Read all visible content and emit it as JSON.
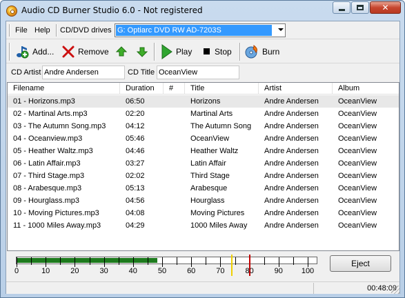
{
  "window": {
    "title": "Audio CD Burner Studio 6.0 - Not registered"
  },
  "menu": {
    "file": "File",
    "help": "Help"
  },
  "drives": {
    "label": "CD/DVD drives",
    "selected": "G: Optiarc DVD RW AD-7203S"
  },
  "toolbar": {
    "add": "Add...",
    "remove": "Remove",
    "play": "Play",
    "stop": "Stop",
    "burn": "Burn"
  },
  "cd": {
    "artist_label": "CD Artist",
    "artist_value": "Andre Andersen",
    "title_label": "CD Title",
    "title_value": "OceanView"
  },
  "table": {
    "columns": [
      "Filename",
      "Duration",
      "#",
      "Title",
      "Artist",
      "Album"
    ],
    "rows": [
      [
        "01 - Horizons.mp3",
        "06:50",
        "",
        "Horizons",
        "Andre Andersen",
        "OceanView"
      ],
      [
        "02 - Martinal Arts.mp3",
        "02:20",
        "",
        "Martinal Arts",
        "Andre Andersen",
        "OceanView"
      ],
      [
        "03 - The Autumn Song.mp3",
        "04:12",
        "",
        "The Autumn Song",
        "Andre Andersen",
        "OceanView"
      ],
      [
        "04 - Oceanview.mp3",
        "05:46",
        "",
        "OceanView",
        "Andre Andersen",
        "OceanView"
      ],
      [
        "05 - Heather Waltz.mp3",
        "04:46",
        "",
        "Heather Waltz",
        "Andre Andersen",
        "OceanView"
      ],
      [
        "06 - Latin Affair.mp3",
        "03:27",
        "",
        "Latin Affair",
        "Andre Andersen",
        "OceanView"
      ],
      [
        "07 - Third Stage.mp3",
        "02:02",
        "",
        "Third Stage",
        "Andre Andersen",
        "OceanView"
      ],
      [
        "08 - Arabesque.mp3",
        "05:13",
        "",
        "Arabesque",
        "Andre Andersen",
        "OceanView"
      ],
      [
        "09 - Hourglass.mp3",
        "04:56",
        "",
        "Hourglass",
        "Andre Andersen",
        "OceanView"
      ],
      [
        "10 - Moving Pictures.mp3",
        "04:08",
        "",
        "Moving Pictures",
        "Andre Andersen",
        "OceanView"
      ],
      [
        "11 - 1000 Miles Away.mp3",
        "04:29",
        "",
        "1000 Miles Away",
        "Andre Andersen",
        "OceanView"
      ]
    ],
    "selected_row": 0
  },
  "gauge": {
    "scale_labels": [
      "0",
      "10",
      "20",
      "30",
      "40",
      "50",
      "60",
      "70",
      "80",
      "90",
      "100"
    ],
    "filled_minutes": 48,
    "markers": [
      {
        "minutes": 74,
        "color": "#f0d000"
      },
      {
        "minutes": 80,
        "color": "#c00000"
      }
    ]
  },
  "eject_label": "Eject",
  "status": {
    "total_time": "00:48:09"
  }
}
